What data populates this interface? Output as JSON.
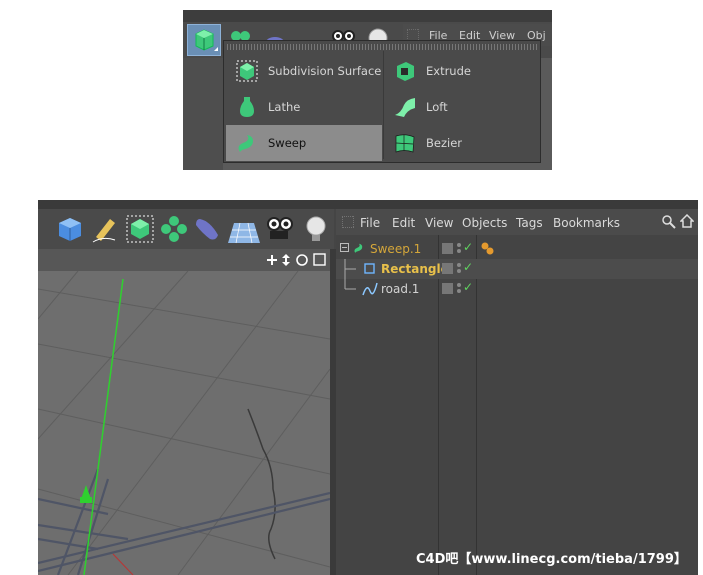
{
  "top": {
    "objmgr_menu": [
      "File",
      "Edit",
      "View",
      "Obj"
    ],
    "generators": [
      {
        "label": "Subdivision Surface",
        "icon": "subdivision-surface-icon"
      },
      {
        "label": "Extrude",
        "icon": "extrude-icon"
      },
      {
        "label": "Lathe",
        "icon": "lathe-icon"
      },
      {
        "label": "Loft",
        "icon": "loft-icon"
      },
      {
        "label": "Sweep",
        "icon": "sweep-icon",
        "selected": true
      },
      {
        "label": "Bezier",
        "icon": "bezier-icon"
      }
    ]
  },
  "bottom": {
    "objmgr_menu": [
      "File",
      "Edit",
      "View",
      "Objects",
      "Tags",
      "Bookmarks"
    ],
    "objects": [
      {
        "name": "Sweep.1",
        "icon": "sweep-icon",
        "color": "#d4a63a"
      },
      {
        "name": "Rectangle",
        "icon": "rectangle-spline-icon",
        "color": "#e8c04a"
      },
      {
        "name": "road.1",
        "icon": "spline-icon",
        "color": "#d2d2d2"
      }
    ]
  },
  "watermark": "C4D吧【www.linecg.com/tieba/1799】",
  "colors": {
    "accent_green": "#55d67a",
    "highlight_yellow": "#e8c04a",
    "check_green": "#5fd35f"
  }
}
